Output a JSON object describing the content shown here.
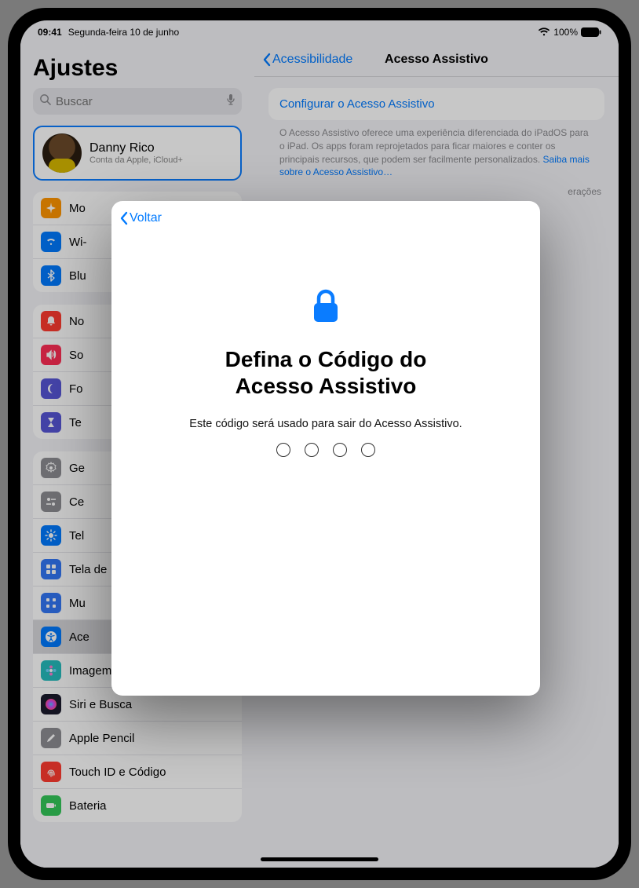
{
  "statusbar": {
    "time": "09:41",
    "date": "Segunda-feira 10 de junho",
    "battery_pct": "100%"
  },
  "sidebar": {
    "title": "Ajustes",
    "search_placeholder": "Buscar",
    "profile": {
      "name": "Danny Rico",
      "subtitle": "Conta da Apple, iCloud+"
    },
    "group1": [
      {
        "label": "Mo",
        "icon": "airplane",
        "bg": "#ff9500"
      },
      {
        "label": "Wi-",
        "icon": "wifi",
        "bg": "#007aff"
      },
      {
        "label": "Blu",
        "icon": "bluetooth",
        "bg": "#007aff"
      }
    ],
    "group2": [
      {
        "label": "No",
        "icon": "bell",
        "bg": "#ff3b30"
      },
      {
        "label": "So",
        "icon": "speaker",
        "bg": "#ff2d55"
      },
      {
        "label": "Fo",
        "icon": "moon",
        "bg": "#5856d6"
      },
      {
        "label": "Te",
        "icon": "hourglass",
        "bg": "#5856d6"
      }
    ],
    "group3": [
      {
        "label": "Ge",
        "icon": "gear",
        "bg": "#8e8e93"
      },
      {
        "label": "Ce",
        "icon": "switches",
        "bg": "#8e8e93"
      },
      {
        "label": "Tel",
        "icon": "sun",
        "bg": "#007aff"
      },
      {
        "label": "Tela de",
        "icon": "grid",
        "bg": "#3478f6"
      },
      {
        "label": "Mu",
        "icon": "apps",
        "bg": "#3478f6"
      },
      {
        "label": "Ace",
        "icon": "accessibility",
        "bg": "#007aff",
        "selected": true
      },
      {
        "label": "Imagem de Fundo",
        "icon": "flower",
        "bg": "#27bdbE"
      },
      {
        "label": "Siri e Busca",
        "icon": "siri",
        "bg": "#1b1b2e"
      },
      {
        "label": "Apple Pencil",
        "icon": "pencil",
        "bg": "#8e8e93"
      },
      {
        "label": "Touch ID e Código",
        "icon": "touchid",
        "bg": "#ff3b30"
      },
      {
        "label": "Bateria",
        "icon": "battery",
        "bg": "#34c759"
      }
    ]
  },
  "main": {
    "back_label": "Acessibilidade",
    "title": "Acesso Assistivo",
    "config_label": "Configurar o Acesso Assistivo",
    "desc": "O Acesso Assistivo oferece uma experiência diferenciada do iPadOS para o iPad. Os apps foram reprojetados para ficar maiores e conter os principais recursos, que podem ser facilmente personalizados.",
    "desc_link": "Saiba mais sobre o Acesso Assistivo…",
    "trailing_word": "erações"
  },
  "modal": {
    "back_label": "Voltar",
    "title_line1": "Defina o Código do",
    "title_line2": "Acesso Assistivo",
    "subtitle": "Este código será usado para sair do Acesso Assistivo.",
    "passcode_length": 4
  }
}
